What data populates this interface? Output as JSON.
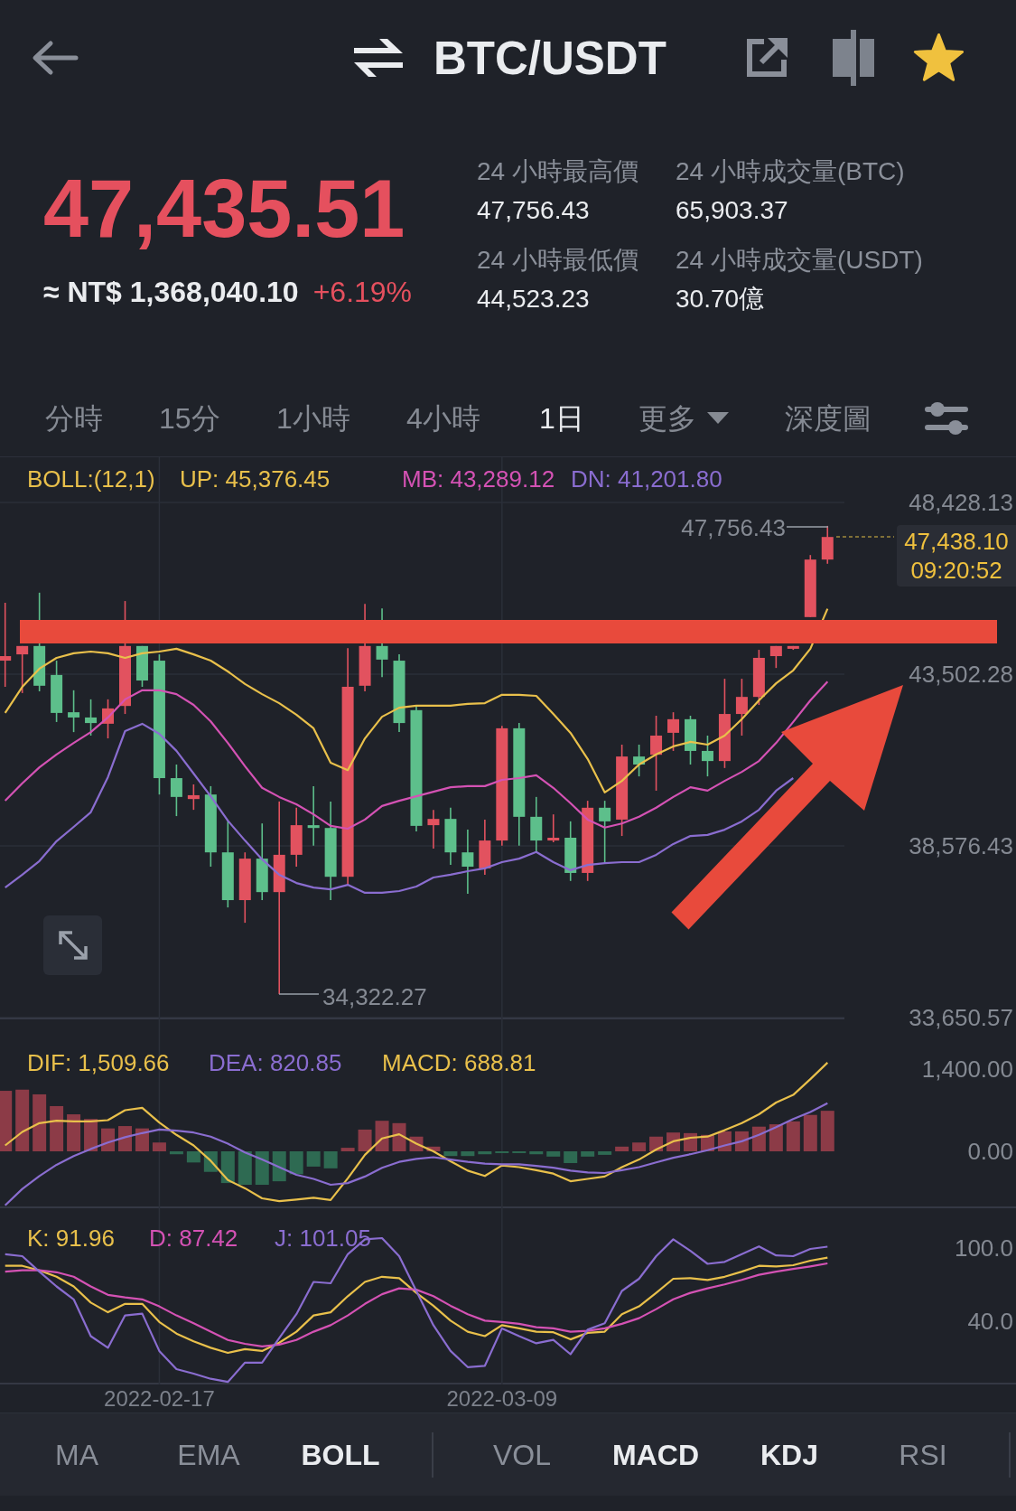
{
  "header": {
    "pair": "BTC/USDT",
    "favorite": true
  },
  "ticker": {
    "last_price": "47,435.51",
    "fiat_value": "≈ NT$ 1,368,040.10",
    "change": "+6.19%"
  },
  "stats": [
    {
      "label": "24 小時最高價",
      "value": "47,756.43"
    },
    {
      "label": "24 小時成交量(BTC)",
      "value": "65,903.37"
    },
    {
      "label": "24 小時最低價",
      "value": "44,523.23"
    },
    {
      "label": "24 小時成交量(USDT)",
      "value": "30.70億"
    }
  ],
  "intervals": [
    {
      "label": "分時",
      "kind": "tab",
      "selected": false
    },
    {
      "label": "15分",
      "kind": "tab",
      "selected": false
    },
    {
      "label": "1小時",
      "kind": "tab",
      "selected": false
    },
    {
      "label": "4小時",
      "kind": "tab",
      "selected": false
    },
    {
      "label": "1日",
      "kind": "tab",
      "selected": true
    },
    {
      "label": "更多",
      "kind": "dropdown",
      "selected": false
    },
    {
      "label": "深度圖",
      "kind": "tab",
      "selected": false
    }
  ],
  "price_chart": {
    "legend": [
      {
        "text": "BOLL:(12,1)",
        "color": "#e9c04b"
      },
      {
        "text": "UP: 45,376.45",
        "color": "#e9c04b"
      },
      {
        "text": "MB: 43,289.12",
        "color": "#d452b4"
      },
      {
        "text": "DN: 41,201.80",
        "color": "#8a6dd0"
      }
    ],
    "high_label": "47,756.43",
    "low_label": "34,322.27",
    "last_price": "47,438.10",
    "countdown": "09:20:52",
    "chart_data": {
      "type": "candlestick",
      "grid": "y",
      "ylim": [
        33650.57,
        49724.43
      ],
      "yticks": [
        {
          "value": 48428.13,
          "label": "48,428.13"
        },
        {
          "value": 43502.28,
          "label": "43,502.28"
        },
        {
          "value": 38576.43,
          "label": "38,576.43"
        },
        {
          "value": 33650.57,
          "label": "33,650.57"
        }
      ],
      "categories": [
        null,
        null,
        null,
        null,
        null,
        null,
        null,
        null,
        null,
        null,
        null,
        null,
        null,
        null,
        null,
        null,
        null,
        null,
        null,
        null,
        null,
        null,
        null,
        null,
        null,
        null,
        null,
        null,
        null,
        null,
        null,
        null,
        null,
        null,
        null,
        null,
        null,
        null,
        null,
        null,
        null,
        null,
        null,
        null,
        null,
        null,
        null,
        null,
        null
      ],
      "ohlc": [
        [
          43890,
          45550,
          43140,
          44020
        ],
        [
          44070,
          44310,
          42960,
          44310
        ],
        [
          44310,
          45840,
          43010,
          43170
        ],
        [
          43480,
          43890,
          42130,
          42390
        ],
        [
          42410,
          43040,
          41840,
          42260
        ],
        [
          42260,
          42780,
          41740,
          42100
        ],
        [
          42080,
          42780,
          41660,
          42520
        ],
        [
          42590,
          45600,
          42360,
          44310
        ],
        [
          44310,
          44310,
          43140,
          43320
        ],
        [
          43890,
          44070,
          40050,
          40520
        ],
        [
          40520,
          40910,
          39430,
          39980
        ],
        [
          39920,
          40340,
          39610,
          40030
        ],
        [
          40050,
          40290,
          37980,
          38390
        ],
        [
          38390,
          39330,
          36810,
          37020
        ],
        [
          37020,
          38390,
          36370,
          38210
        ],
        [
          38210,
          39220,
          37020,
          37250
        ],
        [
          37250,
          39850,
          34322.27,
          38320
        ],
        [
          38320,
          39670,
          37980,
          39170
        ],
        [
          39170,
          40290,
          38580,
          39090
        ],
        [
          39090,
          39850,
          37020,
          37690
        ],
        [
          37690,
          44250,
          37460,
          43140
        ],
        [
          43170,
          45520,
          43010,
          44310
        ],
        [
          44310,
          45390,
          43420,
          43920
        ],
        [
          43890,
          44070,
          41840,
          42100
        ],
        [
          42470,
          42620,
          38990,
          39150
        ],
        [
          39170,
          39610,
          38500,
          39350
        ],
        [
          39350,
          39670,
          38030,
          38390
        ],
        [
          38390,
          39040,
          37200,
          37980
        ],
        [
          37930,
          39330,
          37750,
          38730
        ],
        [
          38730,
          42020,
          38580,
          41950
        ],
        [
          41950,
          42100,
          38580,
          39410
        ],
        [
          39410,
          39980,
          38390,
          38730
        ],
        [
          38730,
          39480,
          38680,
          38810
        ],
        [
          38810,
          39280,
          37570,
          37800
        ],
        [
          37800,
          39870,
          37570,
          39670
        ],
        [
          39670,
          39870,
          38110,
          39280
        ],
        [
          39330,
          41480,
          38860,
          41140
        ],
        [
          41140,
          41480,
          40570,
          40910
        ],
        [
          41190,
          42310,
          40160,
          41740
        ],
        [
          41820,
          42410,
          41300,
          42210
        ],
        [
          42210,
          42310,
          40910,
          41300
        ],
        [
          41300,
          41740,
          40570,
          41010
        ],
        [
          41010,
          43370,
          40810,
          42360
        ],
        [
          42360,
          43370,
          41740,
          42850
        ],
        [
          42850,
          44200,
          42620,
          43970
        ],
        [
          44020,
          44310,
          43680,
          44310
        ],
        [
          44230,
          44310,
          44200,
          44310
        ],
        [
          45140,
          46920,
          45140,
          46790
        ],
        [
          46790,
          47756.43,
          46670,
          47438.1
        ]
      ],
      "series": [
        {
          "type": "line",
          "color": "#e9c04b",
          "values": [
            42390,
            43140,
            43660,
            43970,
            44100,
            44150,
            44100,
            43970,
            44100,
            44150,
            44230,
            44070,
            43890,
            43580,
            43220,
            42930,
            42670,
            42340,
            41950,
            40960,
            40750,
            41660,
            42280,
            42540,
            42600,
            42600,
            42600,
            42650,
            42670,
            42910,
            42910,
            42880,
            42360,
            41820,
            41070,
            40110,
            40440,
            40910,
            41200,
            41430,
            41560,
            41480,
            41740,
            42210,
            42750,
            43240,
            43610,
            44230,
            45380
          ]
        },
        {
          "type": "line",
          "color": "#d452b4",
          "values": [
            39870,
            40370,
            40830,
            41200,
            41530,
            41840,
            42260,
            42780,
            43040,
            43040,
            42930,
            42620,
            42150,
            41530,
            40860,
            40240,
            39980,
            39770,
            39480,
            39150,
            39070,
            39330,
            39720,
            39870,
            40000,
            40130,
            40260,
            40290,
            40290,
            40470,
            40520,
            40600,
            40240,
            39800,
            39330,
            39100,
            39220,
            39410,
            39670,
            39980,
            40260,
            40160,
            40440,
            40700,
            41010,
            41530,
            42130,
            42750,
            43290
          ]
        },
        {
          "type": "line",
          "color": "#8a6dd0",
          "values": [
            37380,
            37750,
            38140,
            38710,
            39120,
            39540,
            40550,
            41870,
            42080,
            41790,
            41300,
            40650,
            40000,
            39300,
            38730,
            38190,
            37750,
            37510,
            37380,
            37330,
            37460,
            37230,
            37230,
            37280,
            37410,
            37670,
            37750,
            37850,
            37930,
            38110,
            38210,
            38400,
            38110,
            37880,
            38030,
            38080,
            38110,
            38110,
            38320,
            38630,
            38860,
            38890,
            39040,
            39280,
            39610,
            40160,
            40520,
            null,
            null
          ]
        }
      ]
    }
  },
  "macd_chart": {
    "legend": [
      {
        "text": "DIF: 1,509.66",
        "color": "#e9c04b"
      },
      {
        "text": "DEA: 820.85",
        "color": "#8a6dd0"
      },
      {
        "text": "MACD: 688.81",
        "color": "#e9c04b"
      }
    ],
    "chart_data": {
      "type": "line",
      "grid": "x",
      "ylim": [
        -954,
        2277
      ],
      "yticks": [
        {
          "value": 1400,
          "label": "1,400.00"
        },
        {
          "value": 0,
          "label": "0.00"
        }
      ],
      "categories": [
        null,
        null,
        null,
        null,
        null,
        null,
        null,
        null,
        null,
        null,
        null,
        null,
        null,
        null,
        null,
        null,
        null,
        null,
        null,
        null,
        null,
        null,
        null,
        null,
        null,
        null,
        null,
        null,
        null,
        null,
        null,
        null,
        null,
        null,
        null,
        null,
        null,
        null,
        null,
        null,
        null,
        null,
        null,
        null,
        null,
        null,
        null,
        null,
        null
      ],
      "series": [
        {
          "color": "#e9c04b",
          "values": [
            100,
            330,
            480,
            520,
            510,
            510,
            530,
            700,
            740,
            490,
            280,
            100,
            -160,
            -490,
            -630,
            -800,
            -850,
            -820,
            -790,
            -830,
            -460,
            -60,
            220,
            290,
            130,
            0,
            -170,
            -330,
            -420,
            -240,
            -270,
            -320,
            -380,
            -510,
            -470,
            -430,
            -270,
            -140,
            30,
            170,
            230,
            250,
            360,
            480,
            630,
            830,
            960,
            1230,
            1510
          ]
        },
        {
          "color": "#8a6dd0",
          "values": [
            -920,
            -640,
            -420,
            -230,
            -80,
            40,
            150,
            240,
            310,
            370,
            350,
            320,
            250,
            130,
            -20,
            -140,
            -270,
            -400,
            -470,
            -570,
            -540,
            -430,
            -280,
            -180,
            -130,
            -100,
            -140,
            -180,
            -210,
            -220,
            -220,
            -250,
            -280,
            -330,
            -360,
            -370,
            -320,
            -270,
            -190,
            -110,
            -50,
            20,
            100,
            170,
            280,
            410,
            550,
            670,
            820
          ]
        },
        {
          "type": "bar",
          "color": "#8c3b47",
          "values": [
            1030,
            1050,
            970,
            770,
            630,
            550,
            390,
            430,
            390,
            150,
            null,
            null,
            null,
            null,
            null,
            null,
            null,
            null,
            null,
            null,
            60,
            370,
            520,
            480,
            250,
            80,
            null,
            null,
            null,
            null,
            null,
            null,
            null,
            null,
            null,
            null,
            80,
            150,
            250,
            320,
            310,
            280,
            340,
            340,
            420,
            460,
            510,
            620,
            690
          ]
        },
        {
          "type": "bar",
          "color": "#2e6a52",
          "values": [
            null,
            null,
            null,
            null,
            null,
            null,
            null,
            null,
            null,
            null,
            -50,
            -190,
            -350,
            -540,
            -570,
            -570,
            -510,
            -390,
            -260,
            -290,
            null,
            null,
            null,
            null,
            null,
            null,
            -80,
            -80,
            -50,
            -30,
            -30,
            -50,
            -90,
            -200,
            -90,
            -60,
            null,
            null,
            null,
            null,
            null,
            null,
            null,
            null,
            null,
            null,
            null,
            null,
            null
          ]
        }
      ]
    }
  },
  "kdj_chart": {
    "legend": [
      {
        "text": "K: 91.96",
        "color": "#e9c04b"
      },
      {
        "text": "D: 87.42",
        "color": "#d452b4"
      },
      {
        "text": "J: 101.05",
        "color": "#8a6dd0"
      }
    ],
    "chart_data": {
      "type": "line",
      "grid": "x",
      "ylim": [
        -11.9,
        133.3
      ],
      "yticks": [
        {
          "value": 100,
          "label": "100.0"
        },
        {
          "value": 40,
          "label": "40.0"
        }
      ],
      "categories": [
        null,
        null,
        null,
        null,
        null,
        null,
        null,
        null,
        null,
        "2022-02-17",
        null,
        null,
        null,
        null,
        null,
        null,
        null,
        null,
        null,
        null,
        null,
        null,
        null,
        null,
        null,
        null,
        null,
        null,
        null,
        "2022-03-09",
        null,
        null,
        null,
        null,
        null,
        null,
        null,
        null,
        null,
        null,
        null,
        null,
        null,
        null,
        null,
        null,
        null,
        null,
        null
      ],
      "series": [
        {
          "color": "#e9c04b",
          "values": [
            85.4,
            85.4,
            81.7,
            76.4,
            68.5,
            55.2,
            47.3,
            54.2,
            54.2,
            39.4,
            29.8,
            23.5,
            18.2,
            14,
            17.1,
            15.6,
            22.4,
            31.4,
            44.7,
            47.3,
            60.5,
            72.2,
            76.4,
            75.3,
            63.2,
            52.6,
            40.4,
            31.4,
            27.7,
            36.7,
            34.1,
            31.4,
            30.9,
            25.1,
            30.4,
            31.4,
            45.7,
            52.1,
            63.2,
            74.8,
            75.3,
            73.8,
            76.4,
            80.6,
            85.4,
            84.9,
            85.9,
            89.6,
            92
          ]
        },
        {
          "color": "#d452b4",
          "values": [
            80.6,
            81.7,
            81.7,
            80.1,
            76.4,
            68.5,
            61.6,
            59.5,
            57.9,
            52.1,
            44.7,
            38.3,
            31.4,
            24.6,
            21.4,
            19.3,
            20.8,
            24.6,
            31.4,
            36.7,
            44.7,
            54.2,
            62.1,
            66.9,
            65.8,
            60.5,
            52.6,
            45.7,
            40.4,
            39.4,
            37.8,
            35.1,
            34.1,
            31.4,
            32,
            34.1,
            37.8,
            42.5,
            49.9,
            57.9,
            63.2,
            66.9,
            70.1,
            73.8,
            78,
            80.6,
            82.8,
            84.9,
            87.4
          ]
        },
        {
          "color": "#8a6dd0",
          "values": [
            94.9,
            93.3,
            80.6,
            68.5,
            57.9,
            27.7,
            18.2,
            44.7,
            46.2,
            15.6,
            0.7,
            -3,
            -7.2,
            -9.8,
            6,
            6,
            26.1,
            45.7,
            72.2,
            71.1,
            94.9,
            107.1,
            108.1,
            93.3,
            64.8,
            36.7,
            15.6,
            2.3,
            3.4,
            34.1,
            27.7,
            21.9,
            24.6,
            12.9,
            33,
            38.3,
            64.8,
            74.8,
            93.3,
            107.1,
            97.6,
            87,
            88.6,
            94.9,
            101.3,
            93.9,
            93.3,
            99.2,
            101.1
          ]
        }
      ]
    }
  },
  "main_indicators": [
    {
      "label": "MA",
      "selected": false
    },
    {
      "label": "EMA",
      "selected": false
    },
    {
      "label": "BOLL",
      "selected": true
    }
  ],
  "sub_indicators": [
    {
      "label": "VOL",
      "selected": false
    },
    {
      "label": "MACD",
      "selected": true
    },
    {
      "label": "KDJ",
      "selected": true
    },
    {
      "label": "RSI",
      "selected": false
    }
  ]
}
